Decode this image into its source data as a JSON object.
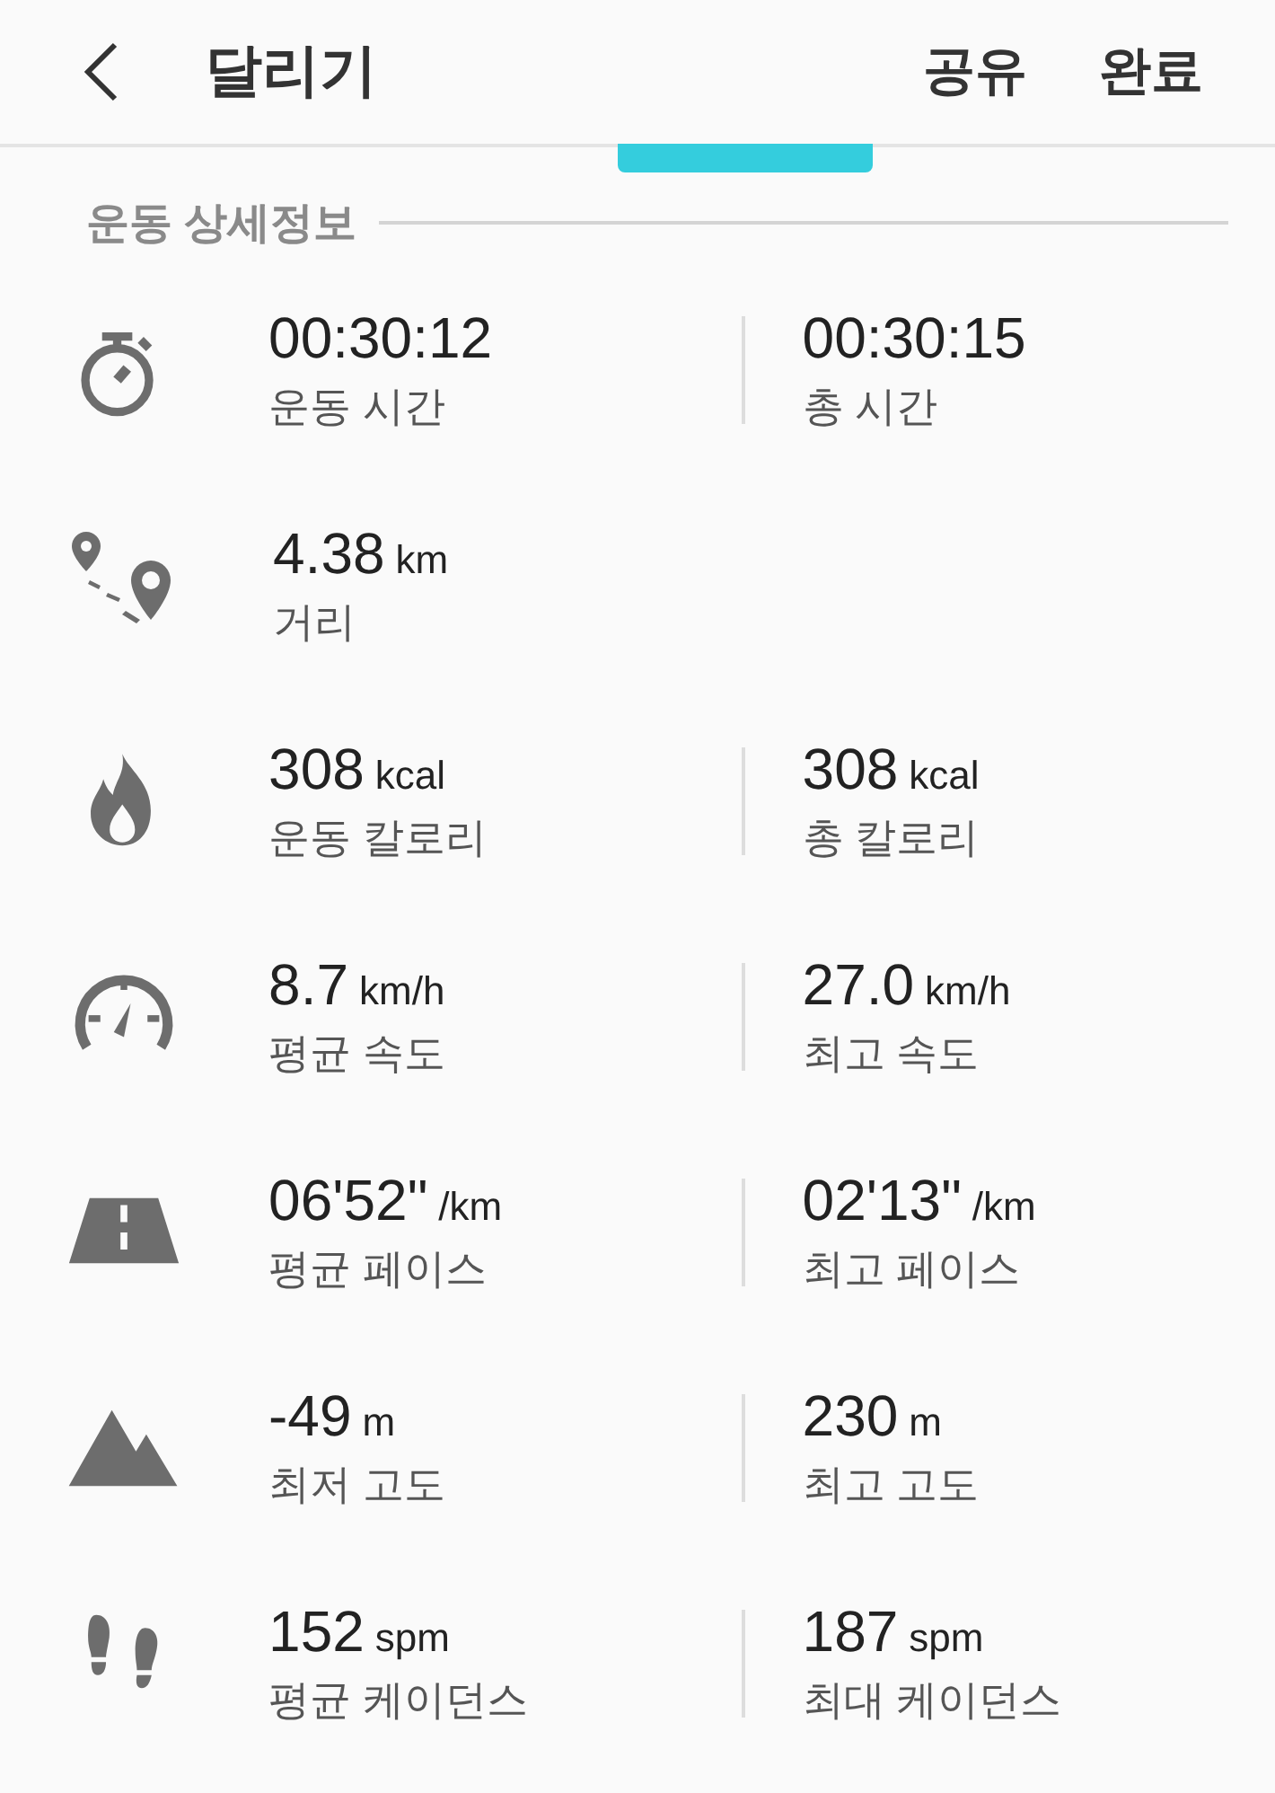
{
  "header": {
    "title": "달리기",
    "actions": [
      "공유",
      "완료"
    ]
  },
  "section_title": "운동 상세정보",
  "stats": [
    {
      "kind": "time",
      "items": [
        {
          "value": "00:30:12",
          "label": "운동 시간"
        },
        {
          "value": "00:30:15",
          "label": "총 시간"
        }
      ]
    },
    {
      "kind": "distance",
      "items": [
        {
          "value": "4.38",
          "unit": "km",
          "label": "거리"
        }
      ]
    },
    {
      "kind": "calories",
      "items": [
        {
          "value": "308",
          "unit": "kcal",
          "label": "운동 칼로리"
        },
        {
          "value": "308",
          "unit": "kcal",
          "label": "총 칼로리"
        }
      ]
    },
    {
      "kind": "speed",
      "items": [
        {
          "value": "8.7",
          "unit": "km/h",
          "label": "평균 속도"
        },
        {
          "value": "27.0",
          "unit": "km/h",
          "label": "최고 속도"
        }
      ]
    },
    {
      "kind": "pace",
      "items": [
        {
          "value": "06'52\"",
          "unit": "/km",
          "label": "평균 페이스"
        },
        {
          "value": "02'13\"",
          "unit": "/km",
          "label": "최고 페이스"
        }
      ]
    },
    {
      "kind": "altitude",
      "items": [
        {
          "value": "-49",
          "unit": "m",
          "label": "최저 고도"
        },
        {
          "value": "230",
          "unit": "m",
          "label": "최고 고도"
        }
      ]
    },
    {
      "kind": "cadence",
      "items": [
        {
          "value": "152",
          "unit": "spm",
          "label": "평균 케이던스"
        },
        {
          "value": "187",
          "unit": "spm",
          "label": "최대 케이던스"
        }
      ]
    }
  ]
}
